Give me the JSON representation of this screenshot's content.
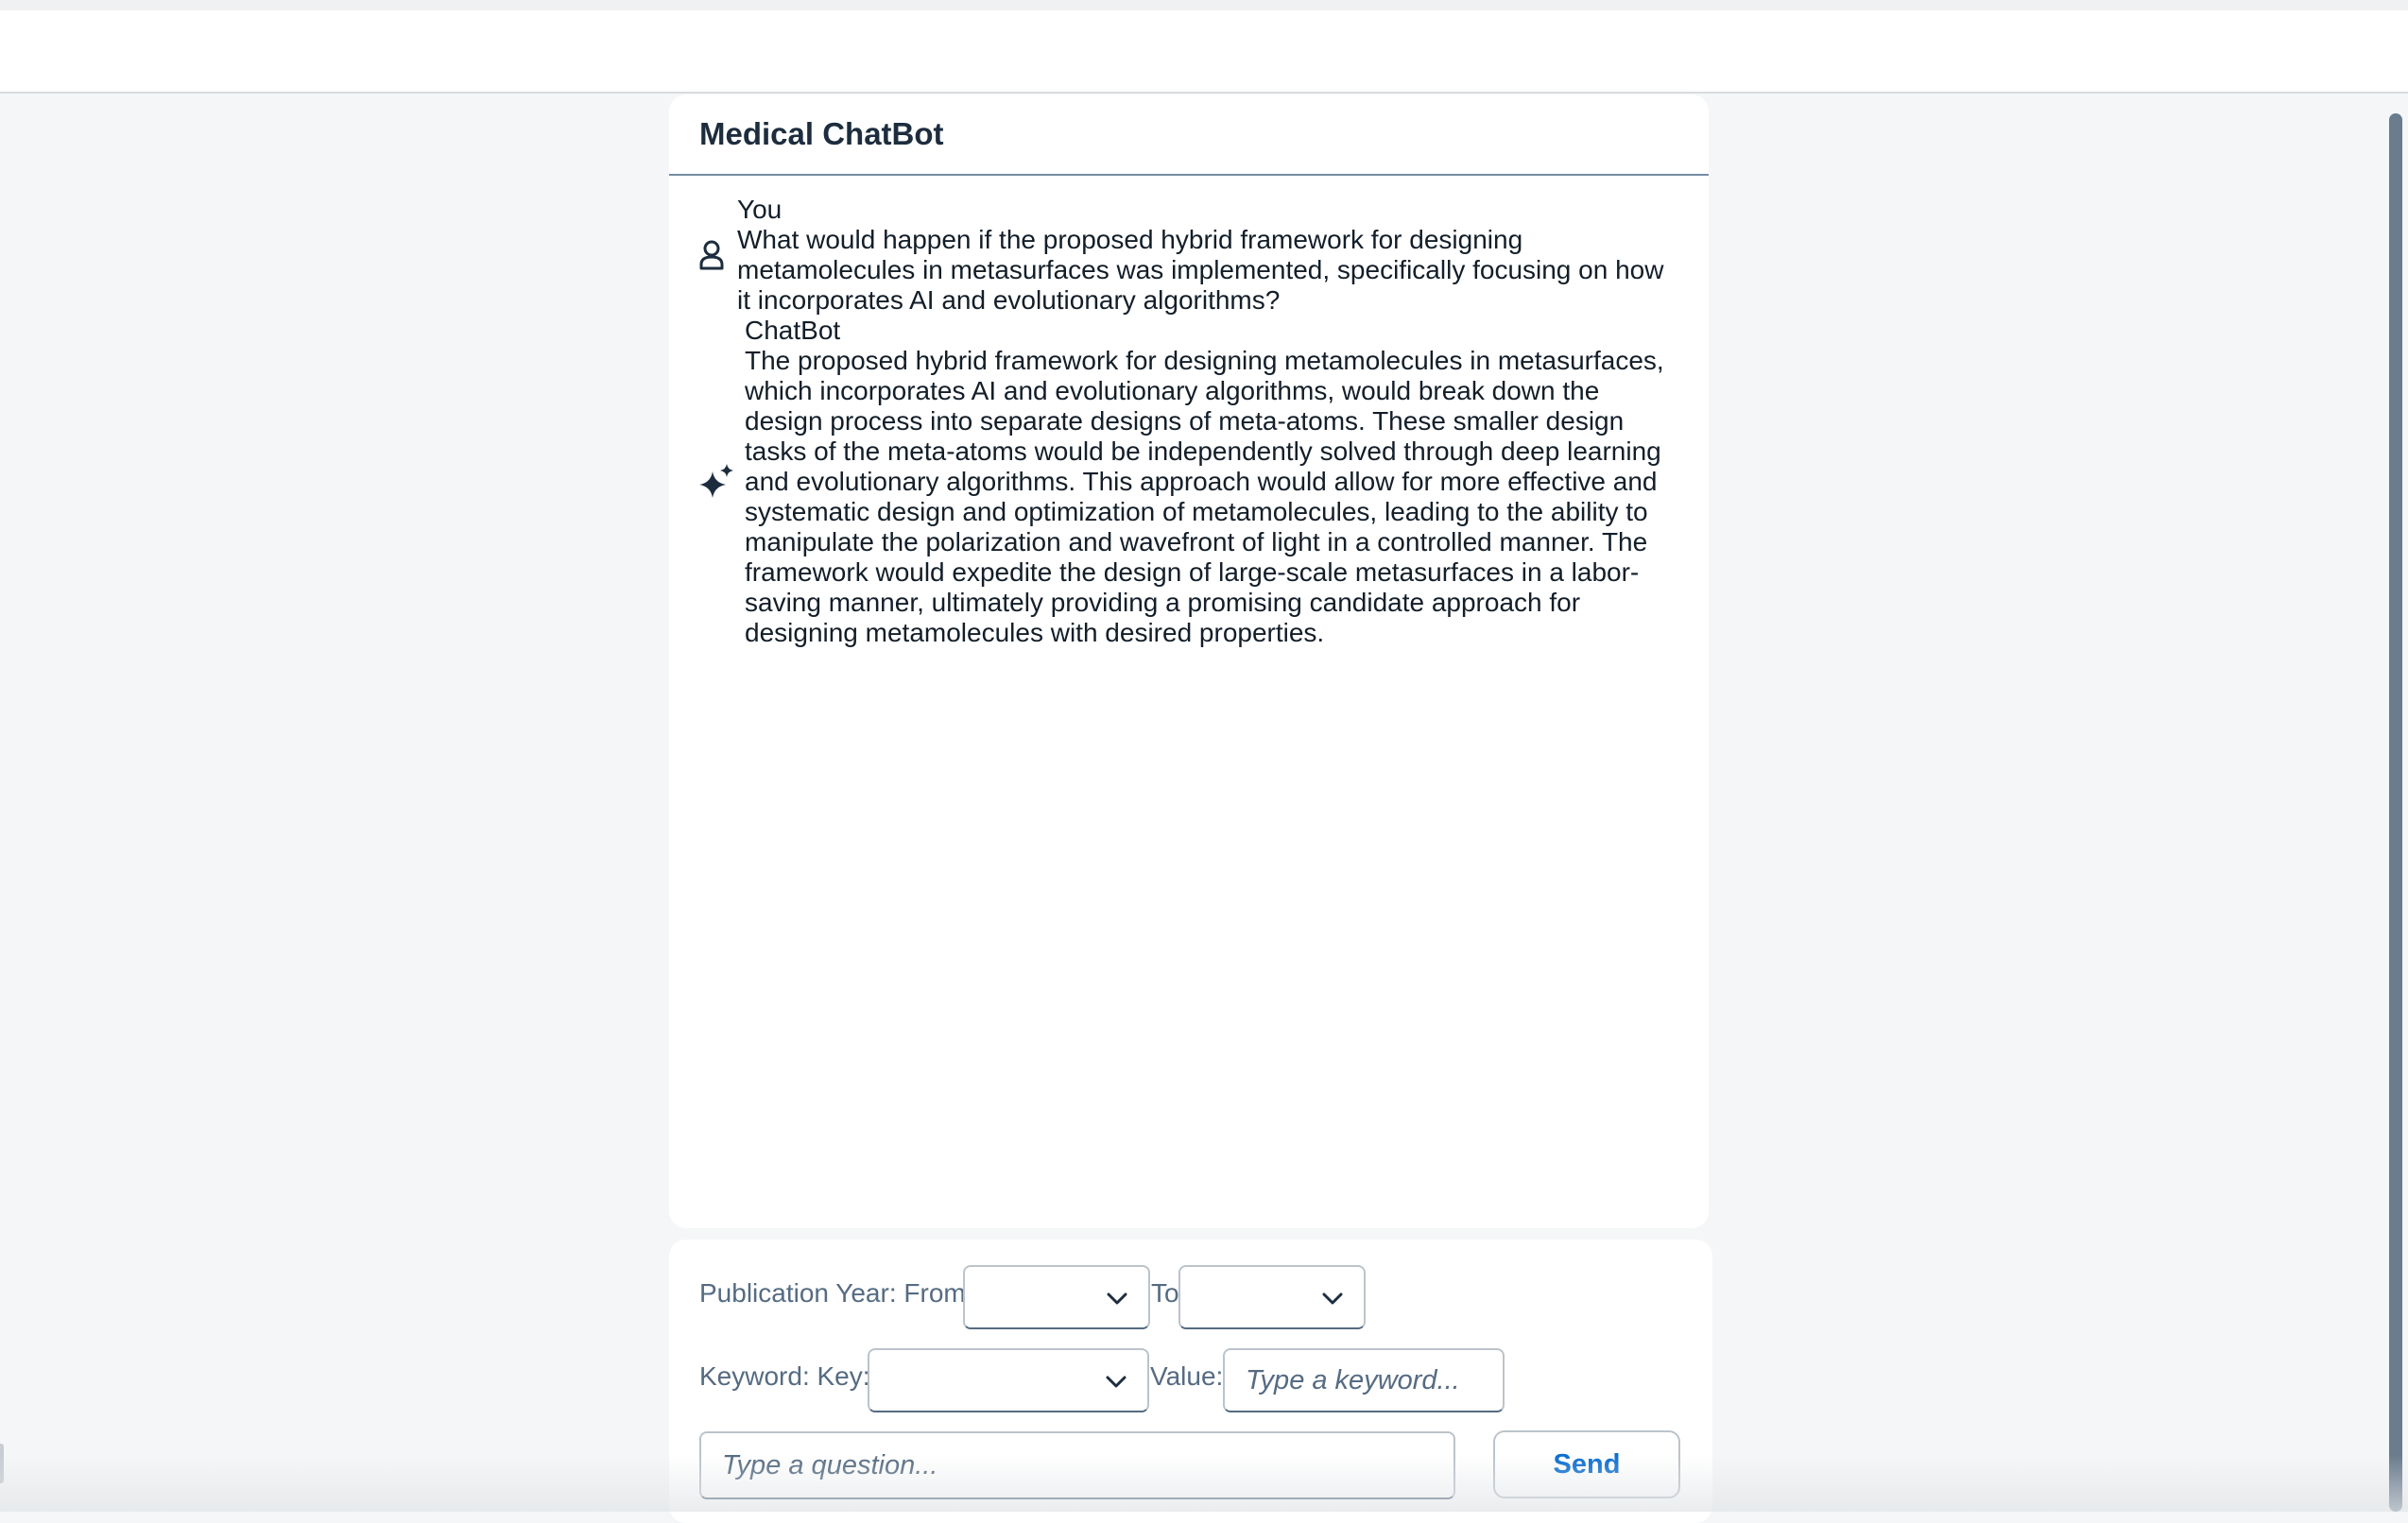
{
  "chat": {
    "title": "Medical ChatBot",
    "messages": [
      {
        "sender": "You",
        "icon": "person-icon",
        "text": "What would happen if the proposed hybrid framework for designing metamolecules in metasurfaces was implemented, specifically focusing on how it incorporates AI and evolutionary algorithms?"
      },
      {
        "sender": "ChatBot",
        "icon": "sparkle-icon",
        "text": "The proposed hybrid framework for designing metamolecules in metasurfaces, which incorporates AI and evolutionary algorithms, would break down the design process into separate designs of meta-atoms. These smaller design tasks of the meta-atoms would be independently solved through deep learning and evolutionary algorithms. This approach would allow for more effective and systematic design and optimization of metamolecules, leading to the ability to manipulate the polarization and wavefront of light in a controlled manner. The framework would expedite the design of large-scale metasurfaces in a labor-saving manner, ultimately providing a promising candidate approach for designing metamolecules with desired properties."
      }
    ]
  },
  "filters": {
    "publication_year_label": "Publication Year: From",
    "to_label": "To",
    "keyword_key_label": "Keyword: Key:",
    "value_label": "Value:",
    "from_value": "",
    "to_value": "",
    "key_value": "",
    "keyword_placeholder": "Type a keyword...",
    "question_placeholder": "Type a question...",
    "send_label": "Send"
  },
  "colors": {
    "accent": "#0a6ed1",
    "text": "#1d2d3e",
    "label": "#556b82"
  }
}
